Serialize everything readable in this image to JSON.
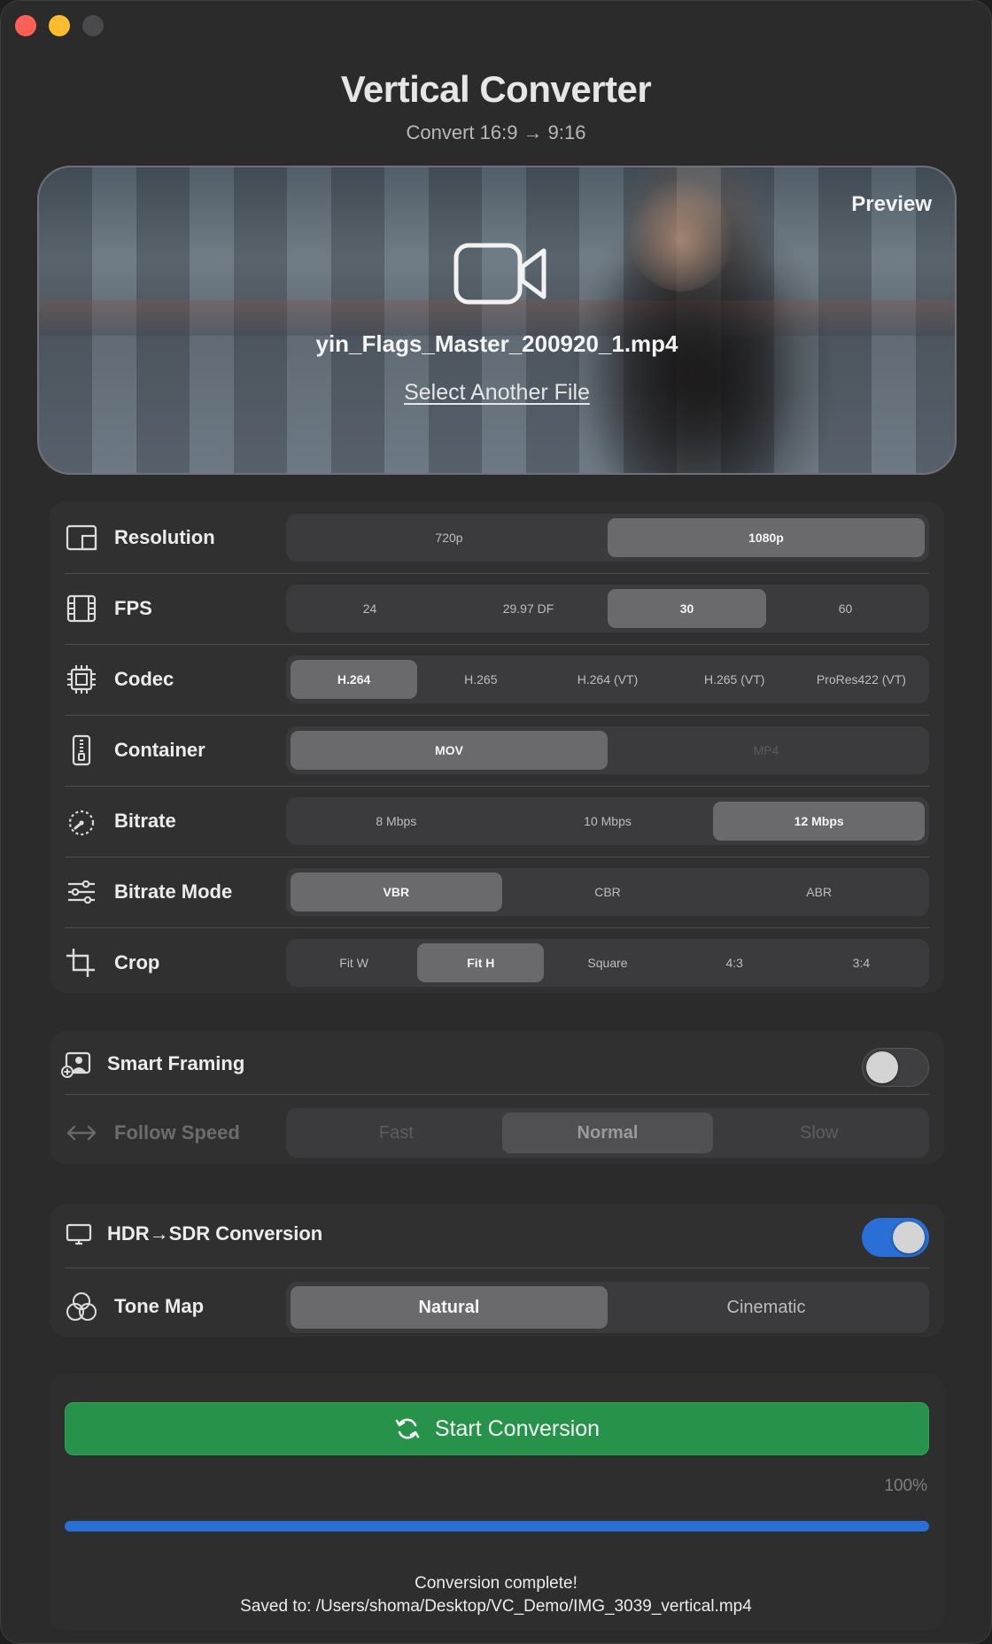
{
  "window": {
    "title": "Vertical Converter",
    "subtitle": "Convert 16:9 → 9:16"
  },
  "preview": {
    "label": "Preview",
    "file_name": "yin_Flags_Master_200920_1.mp4",
    "select_file_label": "Select Another File"
  },
  "settings": {
    "resolution": {
      "label": "Resolution",
      "options": [
        "720p",
        "1080p"
      ],
      "selected": "1080p"
    },
    "fps": {
      "label": "FPS",
      "options": [
        "24",
        "29.97 DF",
        "30",
        "60"
      ],
      "selected": "30"
    },
    "codec": {
      "label": "Codec",
      "options": [
        "H.264",
        "H.265",
        "H.264 (VT)",
        "H.265 (VT)",
        "ProRes422 (VT)"
      ],
      "selected": "H.264"
    },
    "container": {
      "label": "Container",
      "options": [
        "MOV",
        "MP4"
      ],
      "selected": "MOV"
    },
    "bitrate": {
      "label": "Bitrate",
      "options": [
        "8 Mbps",
        "10 Mbps",
        "12 Mbps"
      ],
      "selected": "12 Mbps"
    },
    "bitrate_mode": {
      "label": "Bitrate Mode",
      "options": [
        "VBR",
        "CBR",
        "ABR"
      ],
      "selected": "VBR"
    },
    "crop": {
      "label": "Crop",
      "options": [
        "Fit W",
        "Fit H",
        "Square",
        "4:3",
        "3:4"
      ],
      "selected": "Fit H"
    }
  },
  "smart_framing": {
    "label": "Smart Framing",
    "enabled": false,
    "follow_speed": {
      "label": "Follow Speed",
      "options": [
        "Fast",
        "Normal",
        "Slow"
      ],
      "selected": "Normal"
    }
  },
  "hdr": {
    "label": "HDR→SDR Conversion",
    "enabled": true,
    "tone_map": {
      "label": "Tone Map",
      "options": [
        "Natural",
        "Cinematic"
      ],
      "selected": "Natural"
    }
  },
  "action": {
    "start_label": "Start Conversion",
    "progress_percent": 100,
    "progress_label": "100%",
    "status_line1": "Conversion complete!",
    "status_line2": "Saved to: /Users/shoma/Desktop/VC_Demo/IMG_3039_vertical.mp4"
  },
  "colors": {
    "accent": "#2a6fd6",
    "start_button": "#27934a",
    "background": "#2b2b2c"
  }
}
